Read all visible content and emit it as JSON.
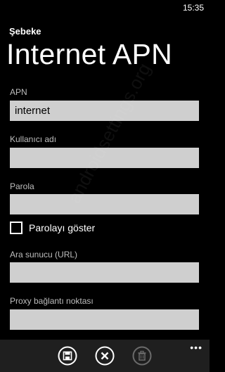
{
  "status_bar": {
    "time": "15:35"
  },
  "header": {
    "app_title": "Şebeke",
    "page_title": "Internet APN"
  },
  "form": {
    "apn": {
      "label": "APN",
      "value": "internet"
    },
    "username": {
      "label": "Kullanıcı adı",
      "value": ""
    },
    "password": {
      "label": "Parola",
      "value": ""
    },
    "show_password": {
      "label": "Parolayı göster",
      "checked": false
    },
    "proxy_server": {
      "label": "Ara sunucu (URL)",
      "value": ""
    },
    "proxy_port": {
      "label": "Proxy bağlantı noktası",
      "value": ""
    }
  },
  "app_bar": {
    "buttons": [
      {
        "icon": "save-icon",
        "enabled": true
      },
      {
        "icon": "cancel-icon",
        "enabled": true
      },
      {
        "icon": "delete-icon",
        "enabled": false
      }
    ],
    "more": "•••"
  },
  "watermark": "androidsettings.org"
}
